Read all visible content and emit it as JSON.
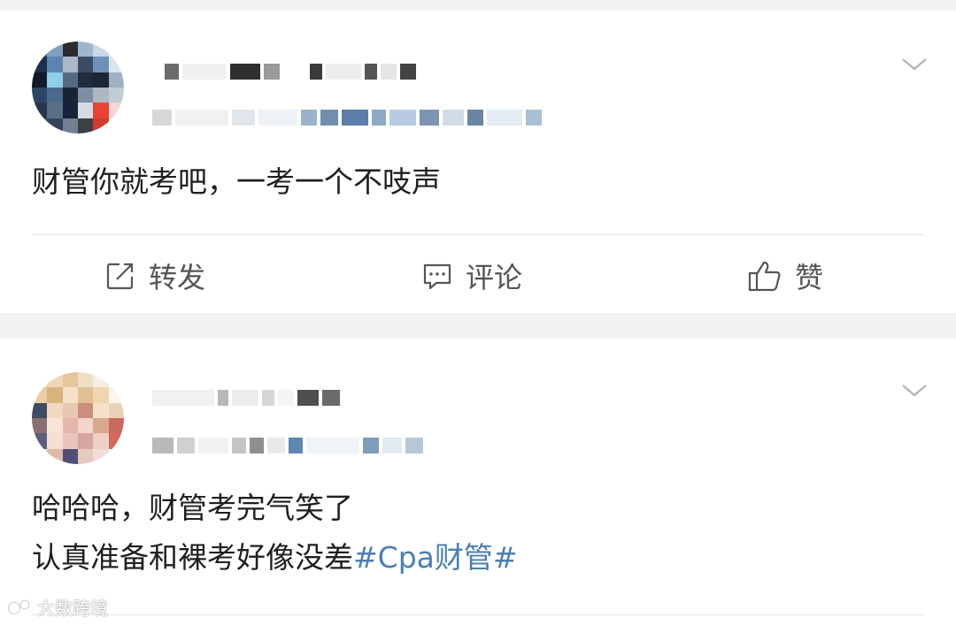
{
  "posts": [
    {
      "text_lines": [
        "财管你就考吧，一考一个不吱声"
      ],
      "actions": {
        "repost": "转发",
        "comment": "评论",
        "like": "赞"
      }
    },
    {
      "text_lines": [
        "哈哈哈，财管考完气笑了",
        "认真准备和裸考好像没差"
      ],
      "hashtag": "#Cpa财管#"
    }
  ],
  "watermark": "大数跨境",
  "icons": {
    "menu": "chevron-down-icon",
    "repost": "repost-edit-icon",
    "comment": "comment-bubble-icon",
    "like": "thumbs-up-icon",
    "watermark": "brand-logo-icon"
  },
  "colors": {
    "background": "#f2f2f2",
    "card": "#ffffff",
    "text": "#1f1f1f",
    "action_text": "#555555",
    "hashtag": "#4a7fb5",
    "divider": "#e6e6e6"
  }
}
